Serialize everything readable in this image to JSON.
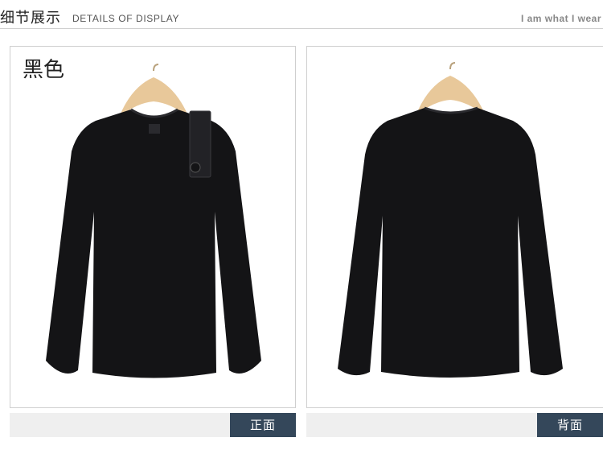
{
  "header": {
    "title_cn": "细节展示",
    "title_en": "DETAILS OF DISPLAY",
    "tagline": "I am what I wear"
  },
  "panels": {
    "front": {
      "color_label": "黑色",
      "view_label": "正面"
    },
    "back": {
      "view_label": "背面"
    }
  },
  "colors": {
    "shirt": "#141416",
    "label_bar": "#34475a",
    "hanger": "#e8c89a"
  }
}
